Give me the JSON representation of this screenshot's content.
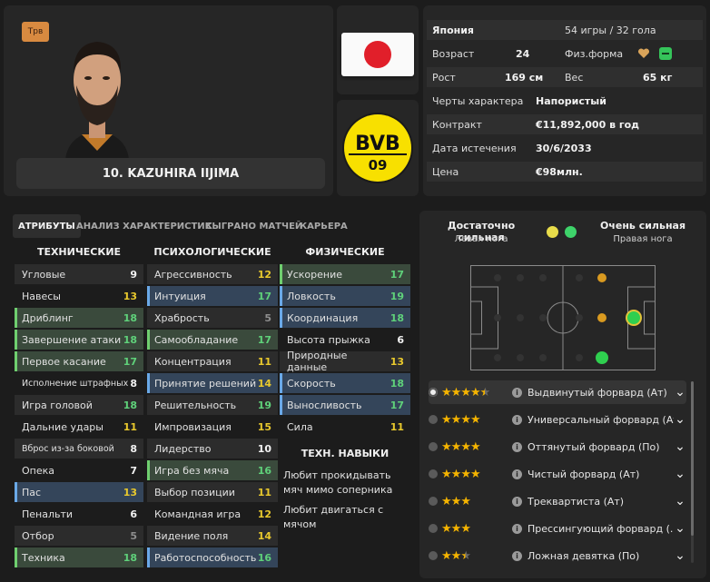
{
  "player": {
    "role_badge": "Трв",
    "name": "10. KAZUHIRA IIJIMA"
  },
  "info": {
    "nation": "Япония",
    "caps": "54 игры / 32 гола",
    "age_label": "Возраст",
    "age": "24",
    "fitness_label": "Физ.форма",
    "height_label": "Рост",
    "height": "169 см",
    "weight_label": "Вес",
    "weight": "65 кг",
    "traits_label": "Черты характера",
    "traits": "Напористый",
    "contract_label": "Контракт",
    "contract": "€11,892,000 в год",
    "expiry_label": "Дата истечения",
    "expiry": "30/6/2033",
    "price_label": "Цена",
    "price": "€98млн."
  },
  "tabs": [
    "АТРИБУТЫ",
    "АНАЛИЗ ХАРАКТЕРИСТИК",
    "СЫГРАНО МАТЧЕЙ",
    "КАРЬЕРА"
  ],
  "technical": {
    "title": "ТЕХНИЧЕСКИЕ",
    "rows": [
      {
        "label": "Угловые",
        "value": "9"
      },
      {
        "label": "Навесы",
        "value": "13"
      },
      {
        "label": "Дриблинг",
        "value": "18"
      },
      {
        "label": "Завершение атаки",
        "value": "18"
      },
      {
        "label": "Первое касание",
        "value": "17"
      },
      {
        "label": "Исполнение штрафных",
        "value": "8"
      },
      {
        "label": "Игра головой",
        "value": "18"
      },
      {
        "label": "Дальние удары",
        "value": "11"
      },
      {
        "label": "Вброс из-за боковой",
        "value": "8"
      },
      {
        "label": "Опека",
        "value": "7"
      },
      {
        "label": "Пас",
        "value": "13"
      },
      {
        "label": "Пенальти",
        "value": "6"
      },
      {
        "label": "Отбор",
        "value": "5"
      },
      {
        "label": "Техника",
        "value": "18"
      }
    ]
  },
  "mental": {
    "title": "ПСИХОЛОГИЧЕСКИЕ",
    "rows": [
      {
        "label": "Агрессивность",
        "value": "12"
      },
      {
        "label": "Интуиция",
        "value": "17"
      },
      {
        "label": "Храбрость",
        "value": "5"
      },
      {
        "label": "Самообладание",
        "value": "17"
      },
      {
        "label": "Концентрация",
        "value": "11"
      },
      {
        "label": "Принятие решений",
        "value": "14"
      },
      {
        "label": "Решительность",
        "value": "19"
      },
      {
        "label": "Импровизация",
        "value": "15"
      },
      {
        "label": "Лидерство",
        "value": "10"
      },
      {
        "label": "Игра без мяча",
        "value": "16"
      },
      {
        "label": "Выбор позиции",
        "value": "11"
      },
      {
        "label": "Командная игра",
        "value": "12"
      },
      {
        "label": "Видение поля",
        "value": "14"
      },
      {
        "label": "Работоспособность",
        "value": "16"
      }
    ]
  },
  "physical": {
    "title": "ФИЗИЧЕСКИЕ",
    "rows": [
      {
        "label": "Ускорение",
        "value": "17"
      },
      {
        "label": "Ловкость",
        "value": "19"
      },
      {
        "label": "Координация",
        "value": "18"
      },
      {
        "label": "Высота прыжка",
        "value": "6"
      },
      {
        "label": "Природные данные",
        "value": "13"
      },
      {
        "label": "Скорость",
        "value": "18"
      },
      {
        "label": "Выносливость",
        "value": "17"
      },
      {
        "label": "Сила",
        "value": "11"
      }
    ]
  },
  "skills": {
    "title": "ТЕХН. НАВЫКИ",
    "items": [
      "Любит прокидывать мяч мимо соперника",
      "Любит двигаться с мячом"
    ]
  },
  "feet": {
    "left_quality": "Достаточно сильная",
    "left_label": "Левая нога",
    "right_quality": "Очень сильная",
    "right_label": "Правая нога"
  },
  "roles": [
    {
      "label": "Выдвинутый форвард (Ат)",
      "rating": 4.5,
      "selected": true
    },
    {
      "label": "Универсальный форвард (Ат)",
      "rating": 4
    },
    {
      "label": "Оттянутый форвард (По)",
      "rating": 4
    },
    {
      "label": "Чистый форвард (Ат)",
      "rating": 4
    },
    {
      "label": "Треквартиста (Ат)",
      "rating": 3
    },
    {
      "label": "Прессингующий форвард (...",
      "rating": 3
    },
    {
      "label": "Ложная девятка (По)",
      "rating": 2.5
    }
  ],
  "colors": {
    "accent_green": "#5fd17a",
    "accent_yellow": "#e9c92d",
    "star": "#f5b400"
  }
}
